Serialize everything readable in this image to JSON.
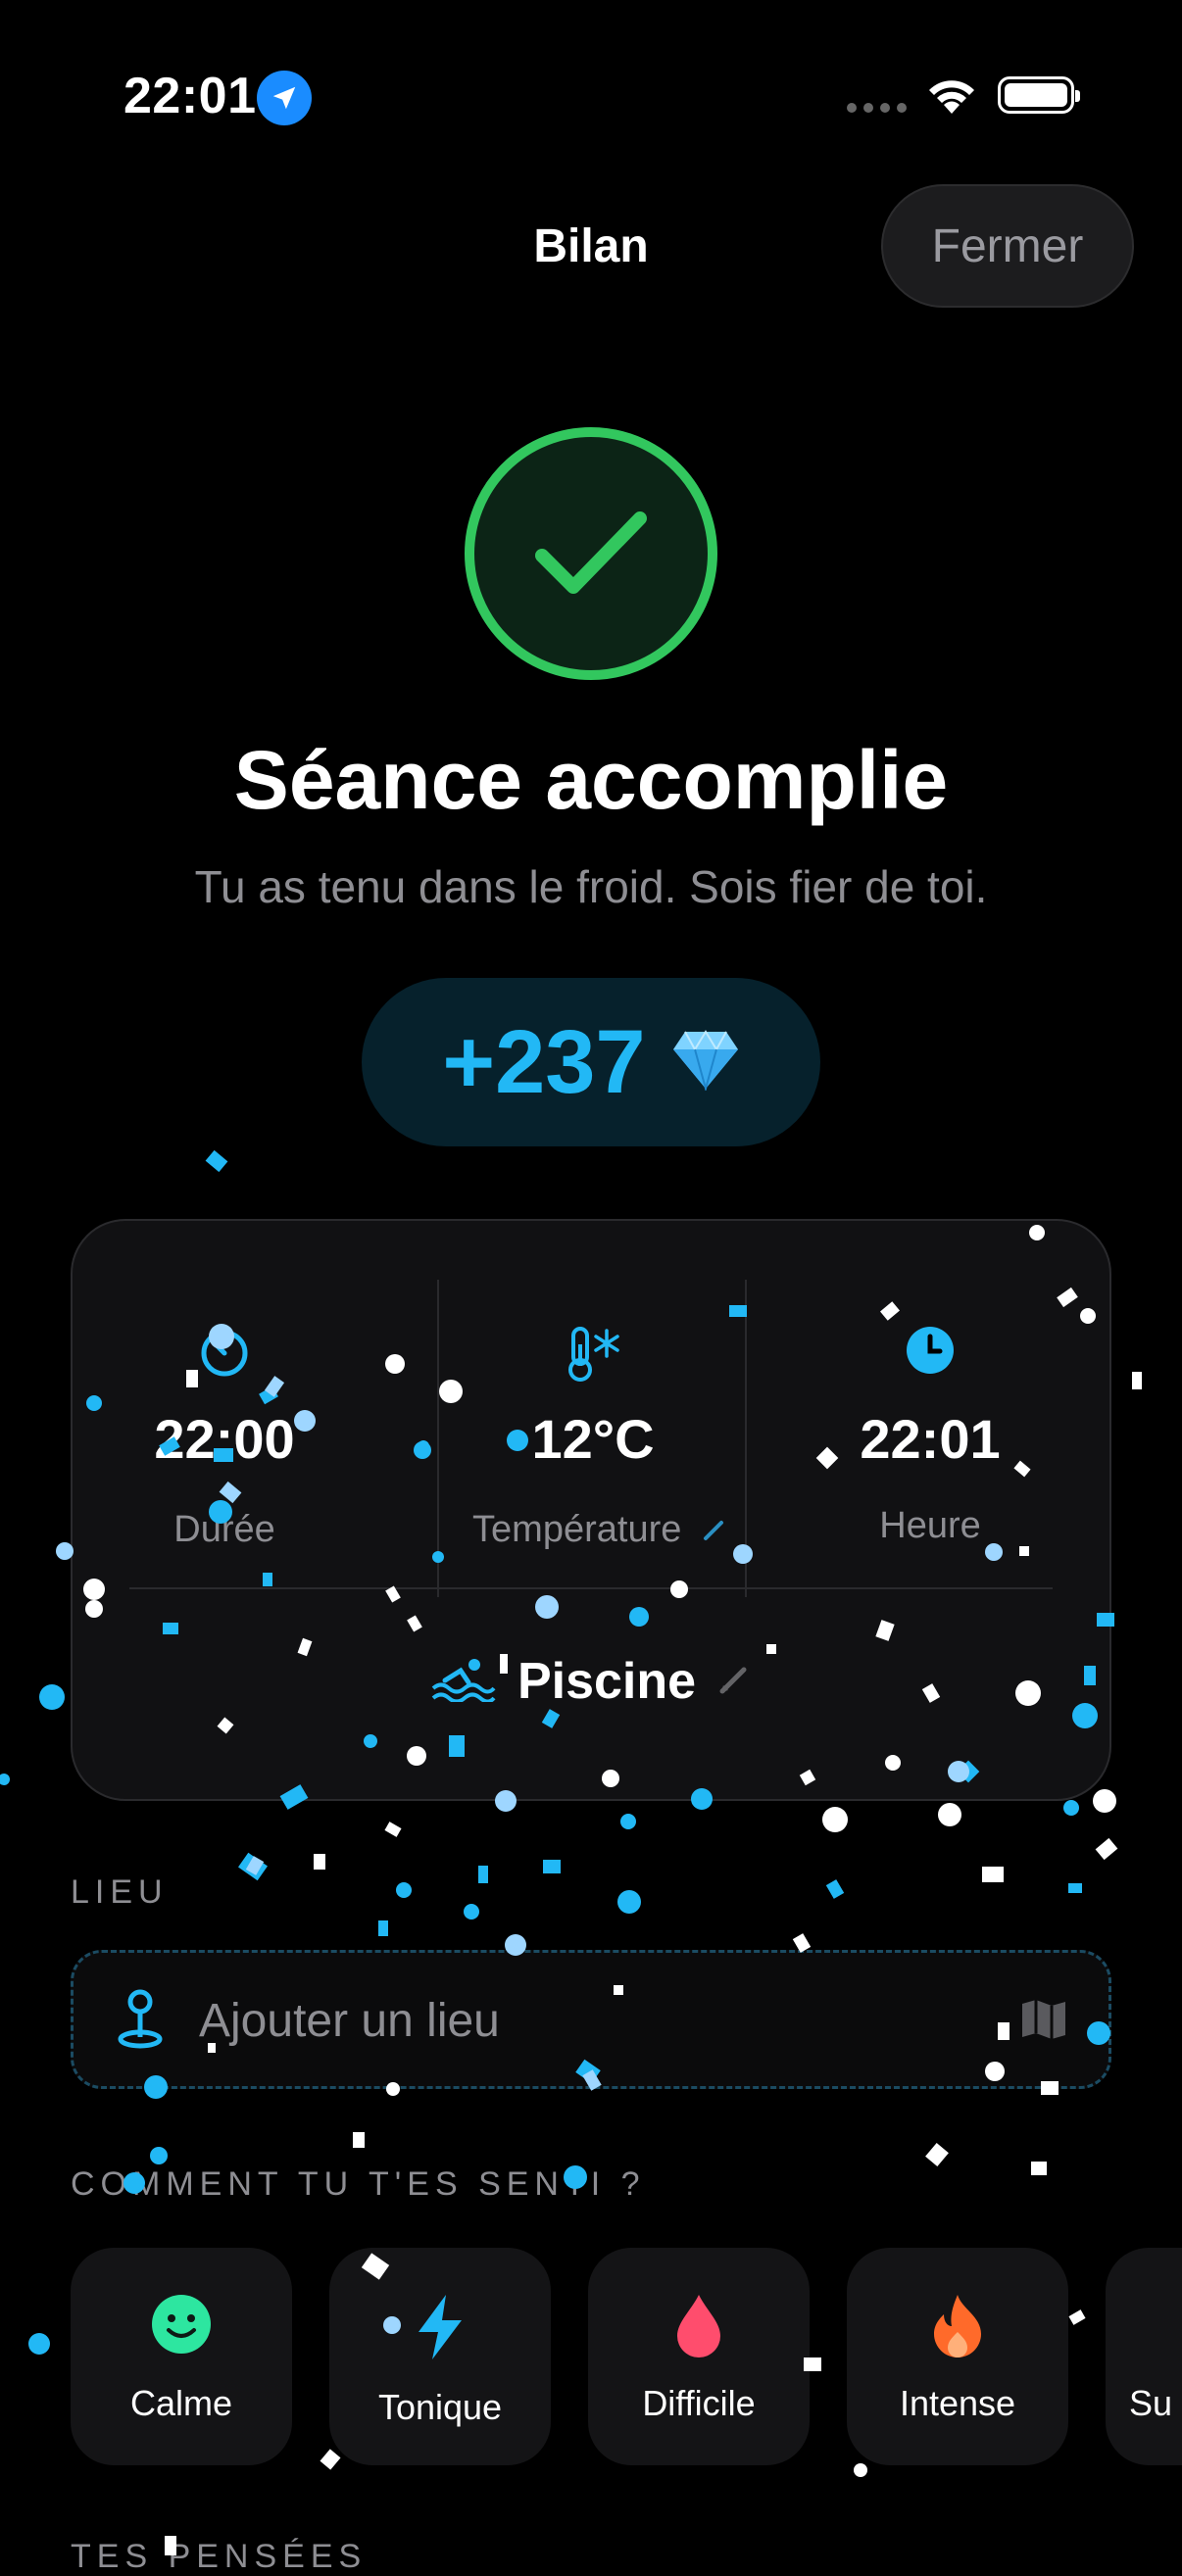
{
  "status_bar": {
    "time": "22:01"
  },
  "nav": {
    "title": "Bilan",
    "close_label": "Fermer"
  },
  "hero": {
    "headline": "Séance accomplie",
    "subtitle": "Tu as tenu dans le froid. Sois fier de toi.",
    "gems": "+237"
  },
  "stats": {
    "duration": {
      "value": "22:00",
      "label": "Durée"
    },
    "temperature": {
      "value": "12°C",
      "label": "Température"
    },
    "time": {
      "value": "22:01",
      "label": "Heure"
    },
    "spot": "Piscine"
  },
  "place": {
    "section_title": "LIEU",
    "placeholder": "Ajouter un lieu"
  },
  "feeling": {
    "section_title": "COMMENT TU T'ES SENTI ?",
    "moods": [
      {
        "label": "Calme",
        "icon": "smiley-icon",
        "color": "#2de6a0"
      },
      {
        "label": "Tonique",
        "icon": "bolt-icon",
        "color": "#22b8f5"
      },
      {
        "label": "Difficile",
        "icon": "drop-icon",
        "color": "#ff4d6d"
      },
      {
        "label": "Intense",
        "icon": "flame-icon",
        "color": "#ff6a2a"
      },
      {
        "label": "Su",
        "icon": "",
        "color": "#ffffff"
      }
    ]
  },
  "thoughts": {
    "section_title": "TES PENSÉES"
  },
  "colors": {
    "accent": "#22b8f5",
    "success": "#32c75e",
    "background": "#000000",
    "card": "#111113"
  }
}
